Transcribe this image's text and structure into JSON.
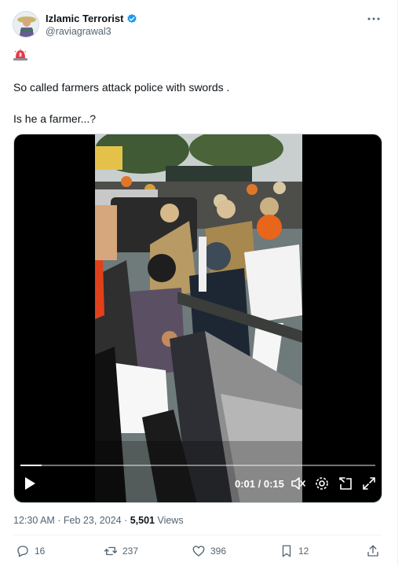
{
  "author": {
    "display_name": "Izlamic Terrorist",
    "handle": "@raviagrawal3"
  },
  "tweet": {
    "lines": [
      "So called farmers attack police with swords .",
      "Is he a farmer...?"
    ]
  },
  "video": {
    "time_display": "0:01 / 0:15",
    "progress_fraction": 0.06
  },
  "meta": {
    "timestamp": "12:30 AM · Feb 23, 2024 · ",
    "views_count": "5,501",
    "views_label": " Views"
  },
  "actions": {
    "replies": "16",
    "reposts": "237",
    "likes": "396",
    "bookmarks": "12"
  },
  "colors": {
    "verified": "#1d9bf0",
    "secondary_text": "#536471",
    "primary_text": "#0f1419"
  },
  "icons": [
    "verified-icon",
    "more-icon",
    "siren-emoji-icon",
    "play-icon",
    "mute-icon",
    "settings-icon",
    "pip-icon",
    "fullscreen-icon",
    "reply-icon",
    "repost-icon",
    "like-icon",
    "bookmark-icon",
    "share-icon"
  ]
}
